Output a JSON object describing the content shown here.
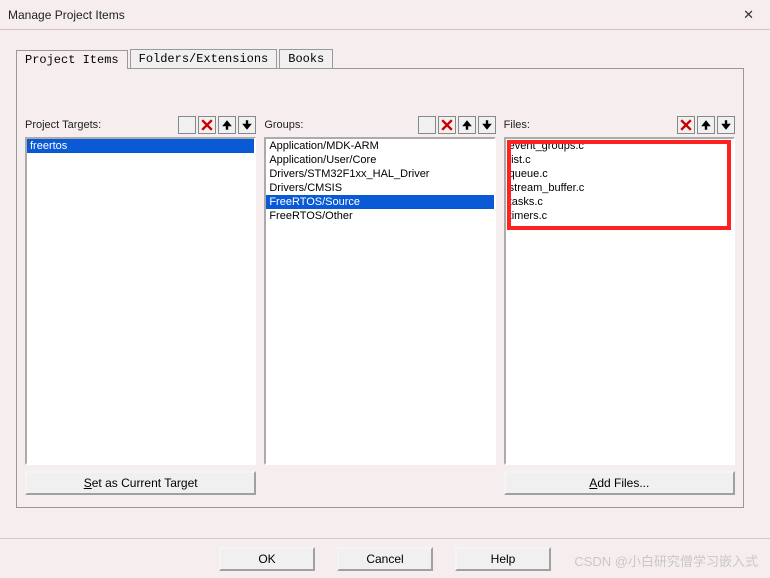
{
  "window": {
    "title": "Manage Project Items"
  },
  "tabs": {
    "t0": "Project Items",
    "t1": "Folders/Extensions",
    "t2": "Books"
  },
  "targets": {
    "label": "Project Targets:",
    "items": [
      "freertos"
    ],
    "button": "Set as Current Target"
  },
  "groups": {
    "label": "Groups:",
    "items": [
      "Application/MDK-ARM",
      "Application/User/Core",
      "Drivers/STM32F1xx_HAL_Driver",
      "Drivers/CMSIS",
      "FreeRTOS/Source",
      "FreeRTOS/Other"
    ],
    "selected_index": 4
  },
  "files": {
    "label": "Files:",
    "items": [
      "event_groups.c",
      "list.c",
      "queue.c",
      "stream_buffer.c",
      "tasks.c",
      "timers.c"
    ],
    "button": "Add Files..."
  },
  "footer": {
    "ok": "OK",
    "cancel": "Cancel",
    "help": "Help"
  },
  "watermark": "CSDN @小白研究僧学习嵌入式"
}
